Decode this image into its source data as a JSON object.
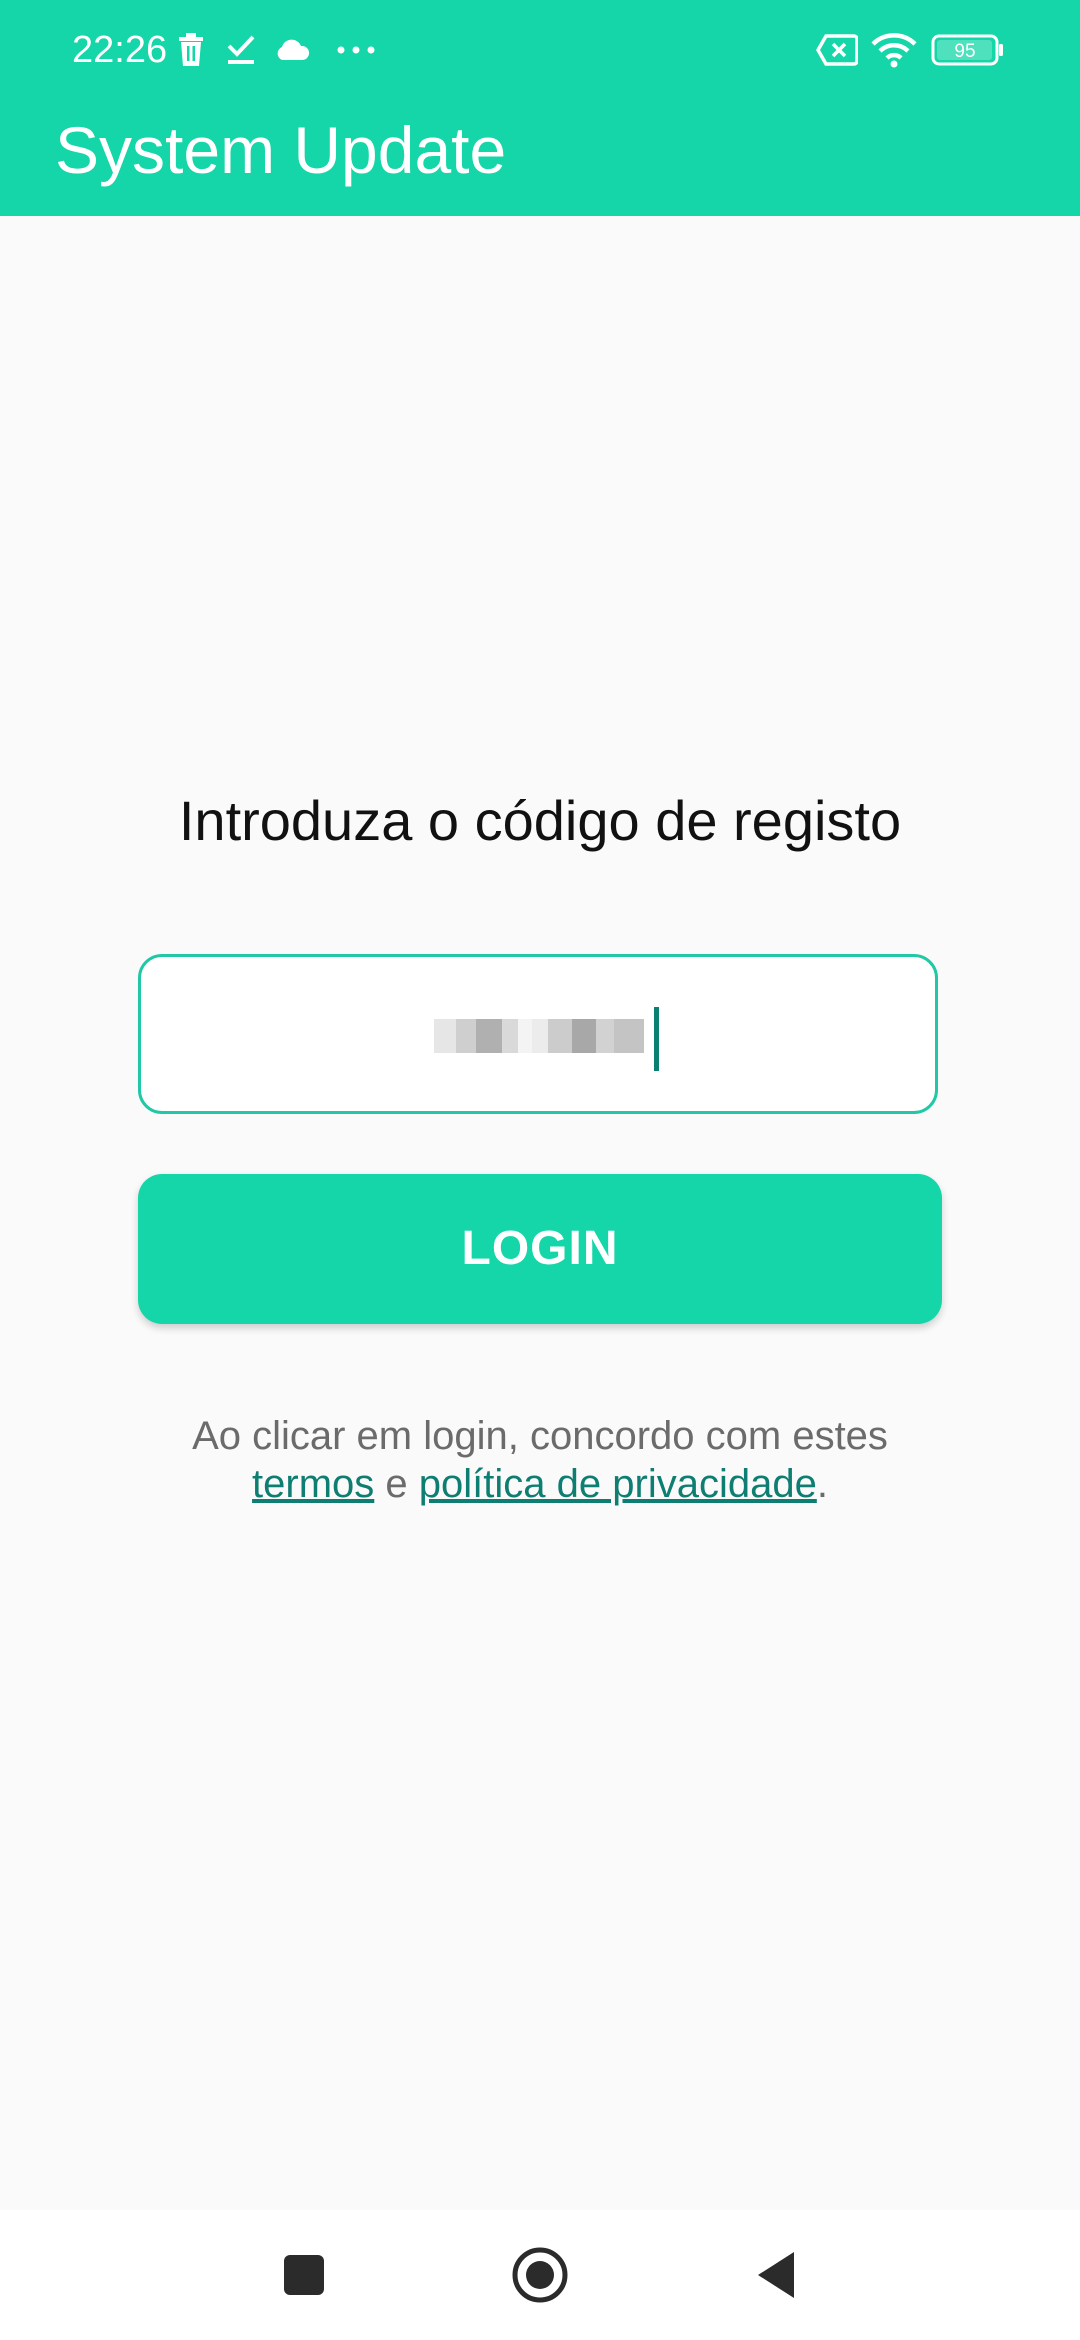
{
  "status_bar": {
    "time": "22:26",
    "battery": "95",
    "icons": [
      "trash-icon",
      "check-icon",
      "cloud-icon",
      "more-dots-icon",
      "no-sim-icon",
      "wifi-icon",
      "battery-icon"
    ]
  },
  "app_bar": {
    "title": "System Update"
  },
  "login": {
    "prompt": "Introduza o código de registo",
    "code_value": "",
    "button_label": "LOGIN",
    "terms_prefix": "Ao clicar em login, concordo com estes",
    "terms_link": "termos",
    "terms_joiner": "e",
    "privacy_link": "política de privacidade",
    "terms_suffix": "."
  },
  "nav_bar": {
    "icons": [
      "recents-square-icon",
      "home-circle-icon",
      "back-triangle-icon"
    ]
  },
  "colors": {
    "accent": "#14d6a8",
    "link": "#0f7e72",
    "field_border": "#20c8a6",
    "background": "#fafafa"
  }
}
